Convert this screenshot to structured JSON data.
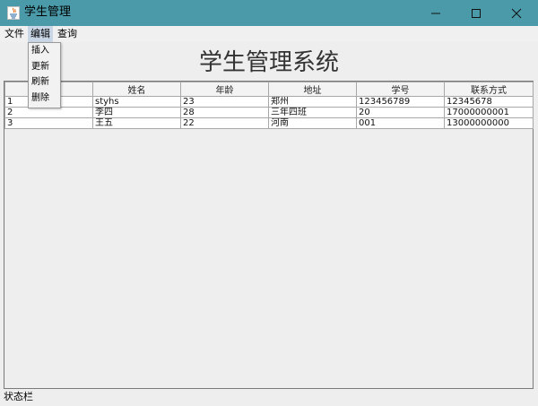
{
  "window": {
    "title": "学生管理"
  },
  "menubar": {
    "items": [
      "文件",
      "编辑",
      "查询"
    ]
  },
  "edit_menu": {
    "items": [
      "插入",
      "更新",
      "刷新",
      "删除"
    ]
  },
  "main": {
    "heading": "学生管理系统"
  },
  "table": {
    "columns": [
      "",
      "姓名",
      "年龄",
      "地址",
      "学号",
      "联系方式"
    ],
    "rows": [
      [
        "1",
        "styhs",
        "23",
        "郑州",
        "123456789",
        "12345678"
      ],
      [
        "2",
        "李四",
        "28",
        "三年四班",
        "20",
        "17000000001"
      ],
      [
        "3",
        "王五",
        "22",
        "河南",
        "001",
        "13000000000"
      ]
    ]
  },
  "statusbar": {
    "text": "状态栏"
  },
  "colors": {
    "titlebar": "#4a9aa9",
    "menu_highlight": "#c8d6e6",
    "background": "#eeeeee"
  },
  "icons": {
    "app": "java-app-icon",
    "minimize": "minimize-icon",
    "maximize": "maximize-icon",
    "close": "close-icon"
  }
}
